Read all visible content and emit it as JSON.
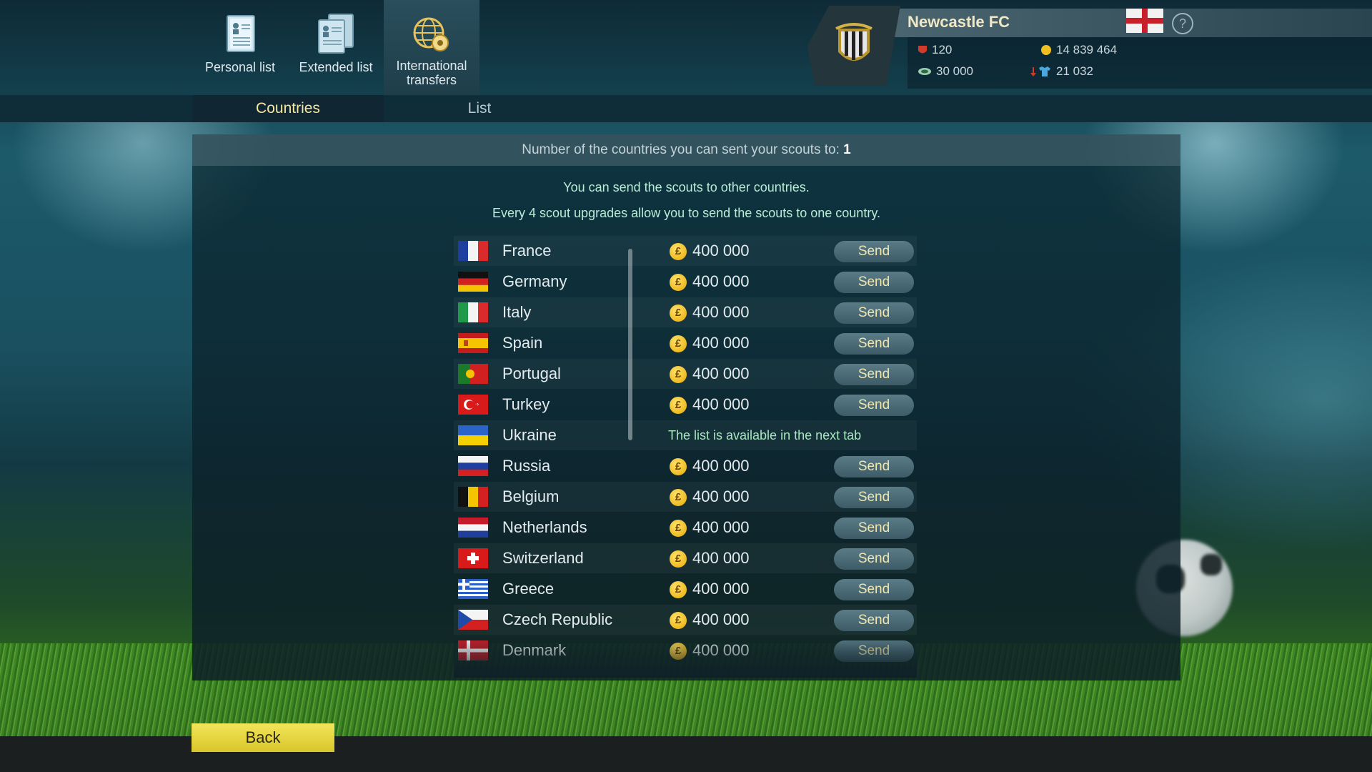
{
  "nav": {
    "personal_list": "Personal list",
    "extended_list": "Extended list",
    "international_transfers_line1": "International",
    "international_transfers_line2": "transfers"
  },
  "subtabs": {
    "countries": "Countries",
    "list": "List"
  },
  "club": {
    "name": "Newcastle FC",
    "stat_top_left": "120",
    "stat_top_right": "14 839 464",
    "stat_bottom_left": "30 000",
    "stat_bottom_right": "21 032",
    "help": "?"
  },
  "panel": {
    "header_text": "Number of the countries you can sent your scouts to: ",
    "header_value": "1",
    "info_line1": "You can send the scouts to other countries.",
    "info_line2": "Every 4 scout upgrades allow you to send the scouts to one country."
  },
  "countries": [
    {
      "name": "France",
      "price": "400 000",
      "action": "Send"
    },
    {
      "name": "Germany",
      "price": "400 000",
      "action": "Send"
    },
    {
      "name": "Italy",
      "price": "400 000",
      "action": "Send"
    },
    {
      "name": "Spain",
      "price": "400 000",
      "action": "Send"
    },
    {
      "name": "Portugal",
      "price": "400 000",
      "action": "Send"
    },
    {
      "name": "Turkey",
      "price": "400 000",
      "action": "Send"
    },
    {
      "name": "Ukraine",
      "note": "The list is available in the next tab"
    },
    {
      "name": "Russia",
      "price": "400 000",
      "action": "Send"
    },
    {
      "name": "Belgium",
      "price": "400 000",
      "action": "Send"
    },
    {
      "name": "Netherlands",
      "price": "400 000",
      "action": "Send"
    },
    {
      "name": "Switzerland",
      "price": "400 000",
      "action": "Send"
    },
    {
      "name": "Greece",
      "price": "400 000",
      "action": "Send"
    },
    {
      "name": "Czech Republic",
      "price": "400 000",
      "action": "Send"
    },
    {
      "name": "Denmark",
      "price": "400 000",
      "action": "Send"
    }
  ],
  "coin_symbol": "£",
  "back_button": "Back"
}
